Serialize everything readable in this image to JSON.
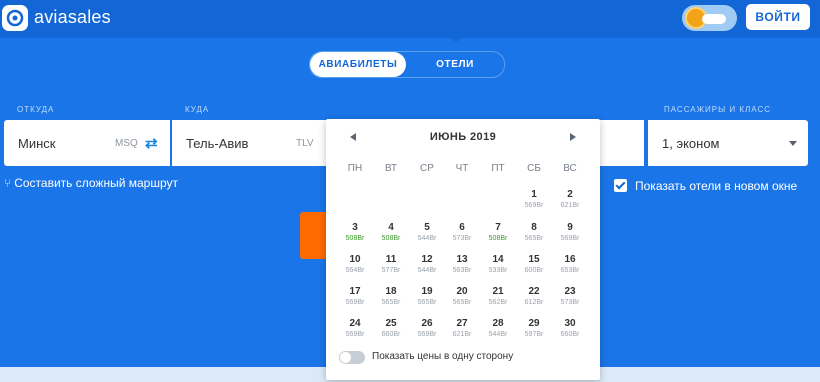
{
  "header": {
    "brand": "aviasales",
    "login_label": "ВОЙТИ"
  },
  "tabs": [
    {
      "label": "АВИАБИЛЕТЫ",
      "active": true
    },
    {
      "label": "ОТЕЛИ",
      "active": false
    }
  ],
  "form": {
    "from_label": "ОТКУДА",
    "to_label": "КУДА",
    "pax_label": "ПАССАЖИРЫ И КЛАСС",
    "from_city": "Минск",
    "from_code": "MSQ",
    "to_city": "Тель-Авив",
    "to_code": "TLV",
    "pax_value": "1, эконом",
    "complex_route": "Составить сложный маршрут",
    "show_hotels": "Показать отели в новом окне",
    "show_hotels_checked": true
  },
  "calendar": {
    "month": "ИЮНЬ 2019",
    "weekdays": [
      "ПН",
      "ВТ",
      "СР",
      "ЧТ",
      "ПТ",
      "СБ",
      "ВС"
    ],
    "one_way_toggle": "Показать цены в одну сторону",
    "one_way_on": false,
    "days": [
      {
        "d": "1",
        "p": "569Br",
        "cheap": false
      },
      {
        "d": "2",
        "p": "621Br",
        "cheap": false
      },
      {
        "d": "3",
        "p": "508Br",
        "cheap": true
      },
      {
        "d": "4",
        "p": "508Br",
        "cheap": true
      },
      {
        "d": "5",
        "p": "544Br",
        "cheap": false
      },
      {
        "d": "6",
        "p": "573Br",
        "cheap": false
      },
      {
        "d": "7",
        "p": "508Br",
        "cheap": true
      },
      {
        "d": "8",
        "p": "565Br",
        "cheap": false
      },
      {
        "d": "9",
        "p": "569Br",
        "cheap": false
      },
      {
        "d": "10",
        "p": "564Br",
        "cheap": false
      },
      {
        "d": "11",
        "p": "577Br",
        "cheap": false
      },
      {
        "d": "12",
        "p": "544Br",
        "cheap": false
      },
      {
        "d": "13",
        "p": "563Br",
        "cheap": false
      },
      {
        "d": "14",
        "p": "533Br",
        "cheap": false
      },
      {
        "d": "15",
        "p": "600Br",
        "cheap": false
      },
      {
        "d": "16",
        "p": "653Br",
        "cheap": false
      },
      {
        "d": "17",
        "p": "569Br",
        "cheap": false
      },
      {
        "d": "18",
        "p": "565Br",
        "cheap": false
      },
      {
        "d": "19",
        "p": "565Br",
        "cheap": false
      },
      {
        "d": "20",
        "p": "565Br",
        "cheap": false
      },
      {
        "d": "21",
        "p": "562Br",
        "cheap": false
      },
      {
        "d": "22",
        "p": "612Br",
        "cheap": false
      },
      {
        "d": "23",
        "p": "573Br",
        "cheap": false
      },
      {
        "d": "24",
        "p": "569Br",
        "cheap": false
      },
      {
        "d": "25",
        "p": "660Br",
        "cheap": false
      },
      {
        "d": "26",
        "p": "569Br",
        "cheap": false
      },
      {
        "d": "27",
        "p": "621Br",
        "cheap": false
      },
      {
        "d": "28",
        "p": "544Br",
        "cheap": false
      },
      {
        "d": "29",
        "p": "597Br",
        "cheap": false
      },
      {
        "d": "30",
        "p": "660Br",
        "cheap": false
      }
    ]
  },
  "colors": {
    "background": "#1a75e8",
    "header": "#1366d6",
    "accent_orange": "#ff6a00",
    "cheap_price": "#3a9a2a"
  },
  "icons": [
    "aviasales-logo-icon",
    "sun-cloud-icon",
    "swap-arrows-icon",
    "route-branch-icon",
    "chevron-left-icon",
    "chevron-right-icon",
    "dropdown-caret-icon",
    "checkbox-checked-icon"
  ]
}
